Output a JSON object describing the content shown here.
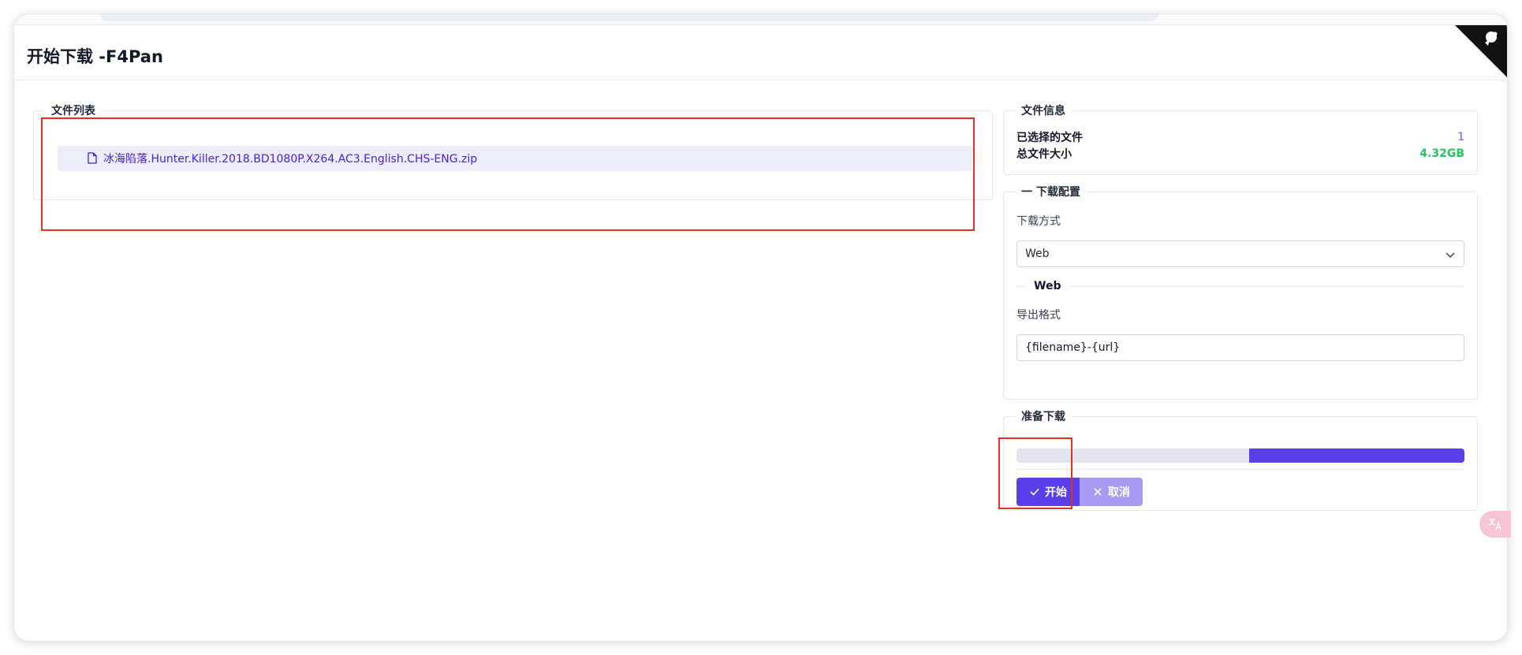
{
  "dialog": {
    "title": "开始下载 -F4Pan"
  },
  "file_list": {
    "legend": "文件列表",
    "files": [
      {
        "name": "冰海陷落.Hunter.Killer.2018.BD1080P.X264.AC3.English.CHS-ENG.zip",
        "icon": "file-icon"
      }
    ]
  },
  "file_info": {
    "legend": "文件信息",
    "selected_label": "已选择的文件",
    "selected_value": "1",
    "total_size_label": "总文件大小",
    "total_size_value": "4.32GB"
  },
  "download_config": {
    "legend": "一 下载配置",
    "method_label": "下载方式",
    "method_value": "Web",
    "section_title": "Web",
    "format_label": "导出格式",
    "format_value": "{filename}-{url}"
  },
  "prepare": {
    "legend": "准备下载",
    "progress_fraction": 0.48,
    "start_label": "开始",
    "cancel_label": "取消"
  },
  "colors": {
    "accent": "#5b3ee8",
    "cancel": "#a99bf2",
    "link": "#4c1dd1",
    "size_green": "#22c55e",
    "highlight_red": "#e0321f"
  },
  "translate_fab": {
    "icon": "translate-icon"
  }
}
